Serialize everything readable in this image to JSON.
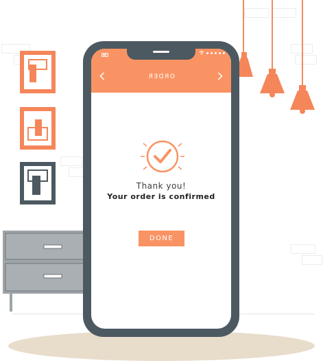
{
  "header": {
    "title": "ORDER",
    "back_icon": "chevron-left-icon",
    "forward_icon": "chevron-right-icon"
  },
  "confirmation": {
    "icon": "check-circle-icon",
    "thanks_text": "Thank you!",
    "message": "Your order is confirmed"
  },
  "done_button": {
    "label": "DONE"
  },
  "colors": {
    "accent": "#f99363",
    "phone_body": "#4c5961",
    "frame_accent": "#f5865a",
    "frame_dark": "#4c5961",
    "cabinet": "#9ea4a8"
  }
}
